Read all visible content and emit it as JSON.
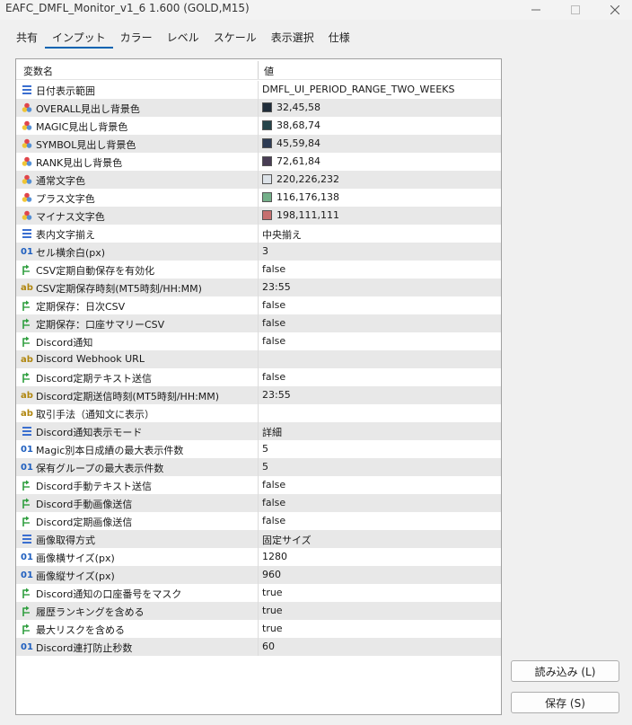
{
  "window": {
    "title": "EAFC_DMFL_Monitor_v1_6 1.600 (GOLD,M15)"
  },
  "tabs": [
    {
      "label": "共有"
    },
    {
      "label": "インプット"
    },
    {
      "label": "カラー"
    },
    {
      "label": "レベル"
    },
    {
      "label": "スケール"
    },
    {
      "label": "表示選択"
    },
    {
      "label": "仕様"
    }
  ],
  "table": {
    "col_name": "変数名",
    "col_value": "値",
    "rows": [
      {
        "type": "enum",
        "name": "日付表示範囲",
        "value": "DMFL_UI_PERIOD_RANGE_TWO_WEEKS"
      },
      {
        "type": "color",
        "name": "OVERALL見出し背景色",
        "value": "32,45,58",
        "swatch": "#202d3a"
      },
      {
        "type": "color",
        "name": "MAGIC見出し背景色",
        "value": "38,68,74",
        "swatch": "#26444a"
      },
      {
        "type": "color",
        "name": "SYMBOL見出し背景色",
        "value": "45,59,84",
        "swatch": "#2d3b54"
      },
      {
        "type": "color",
        "name": "RANK見出し背景色",
        "value": "72,61,84",
        "swatch": "#483d54"
      },
      {
        "type": "color",
        "name": "通常文字色",
        "value": "220,226,232",
        "swatch": "#dce2e8"
      },
      {
        "type": "color",
        "name": "プラス文字色",
        "value": "116,176,138",
        "swatch": "#74b08a"
      },
      {
        "type": "color",
        "name": "マイナス文字色",
        "value": "198,111,111",
        "swatch": "#c66f6f"
      },
      {
        "type": "enum",
        "name": "表内文字揃え",
        "value": "中央揃え"
      },
      {
        "type": "int",
        "name": "セル横余白(px)",
        "value": "3"
      },
      {
        "type": "bool",
        "name": "CSV定期自動保存を有効化",
        "value": "false"
      },
      {
        "type": "string",
        "name": "CSV定期保存時刻(MT5時刻/HH:MM)",
        "value": "23:55"
      },
      {
        "type": "bool",
        "name": "定期保存：日次CSV",
        "value": "false"
      },
      {
        "type": "bool",
        "name": "定期保存：口座サマリーCSV",
        "value": "false"
      },
      {
        "type": "bool",
        "name": "Discord通知",
        "value": "false"
      },
      {
        "type": "string",
        "name": "Discord Webhook URL",
        "value": ""
      },
      {
        "type": "bool",
        "name": "Discord定期テキスト送信",
        "value": "false"
      },
      {
        "type": "string",
        "name": "Discord定期送信時刻(MT5時刻/HH:MM)",
        "value": "23:55"
      },
      {
        "type": "string",
        "name": "取引手法（通知文に表示）",
        "value": ""
      },
      {
        "type": "enum",
        "name": "Discord通知表示モード",
        "value": "詳細"
      },
      {
        "type": "int",
        "name": "Magic別本日成績の最大表示件数",
        "value": "5"
      },
      {
        "type": "int",
        "name": "保有グループの最大表示件数",
        "value": "5"
      },
      {
        "type": "bool",
        "name": "Discord手動テキスト送信",
        "value": "false"
      },
      {
        "type": "bool",
        "name": "Discord手動画像送信",
        "value": "false"
      },
      {
        "type": "bool",
        "name": "Discord定期画像送信",
        "value": "false"
      },
      {
        "type": "enum",
        "name": "画像取得方式",
        "value": "固定サイズ"
      },
      {
        "type": "int",
        "name": "画像横サイズ(px)",
        "value": "1280"
      },
      {
        "type": "int",
        "name": "画像縦サイズ(px)",
        "value": "960"
      },
      {
        "type": "bool",
        "name": "Discord通知の口座番号をマスク",
        "value": "true"
      },
      {
        "type": "bool",
        "name": "履歴ランキングを含める",
        "value": "true"
      },
      {
        "type": "bool",
        "name": "最大リスクを含める",
        "value": "true"
      },
      {
        "type": "int",
        "name": "Discord連打防止秒数",
        "value": "60"
      }
    ]
  },
  "buttons": {
    "load_label": "読み込み (L)",
    "save_label": "保存 (S)"
  },
  "icons": {
    "int_glyph": "01",
    "string_glyph": "ab"
  }
}
